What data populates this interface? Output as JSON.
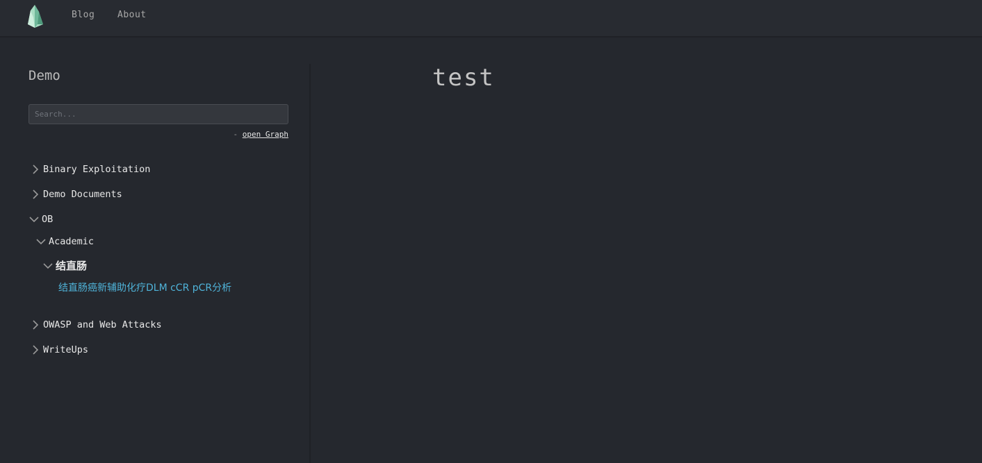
{
  "nav": {
    "logo_icon": "crystal-logo-icon",
    "links": [
      "Blog",
      "About"
    ]
  },
  "sidebar": {
    "title": "Demo",
    "search_placeholder": "Search...",
    "graph_prefix": "- ",
    "graph_link": "open Graph",
    "tree": {
      "binary": "Binary Exploitation",
      "demo_docs": "Demo Documents",
      "ob": "OB",
      "academic": "Academic",
      "crc": "结直肠",
      "leaf": "结直肠癌新辅助化疗DLM cCR pCR分析",
      "owasp": "OWASP and Web Attacks",
      "writeups": "WriteUps"
    }
  },
  "main": {
    "title": "test"
  },
  "colors": {
    "background": "#25282e",
    "topbar": "#282b31",
    "link_accent": "#4fb3d9"
  }
}
